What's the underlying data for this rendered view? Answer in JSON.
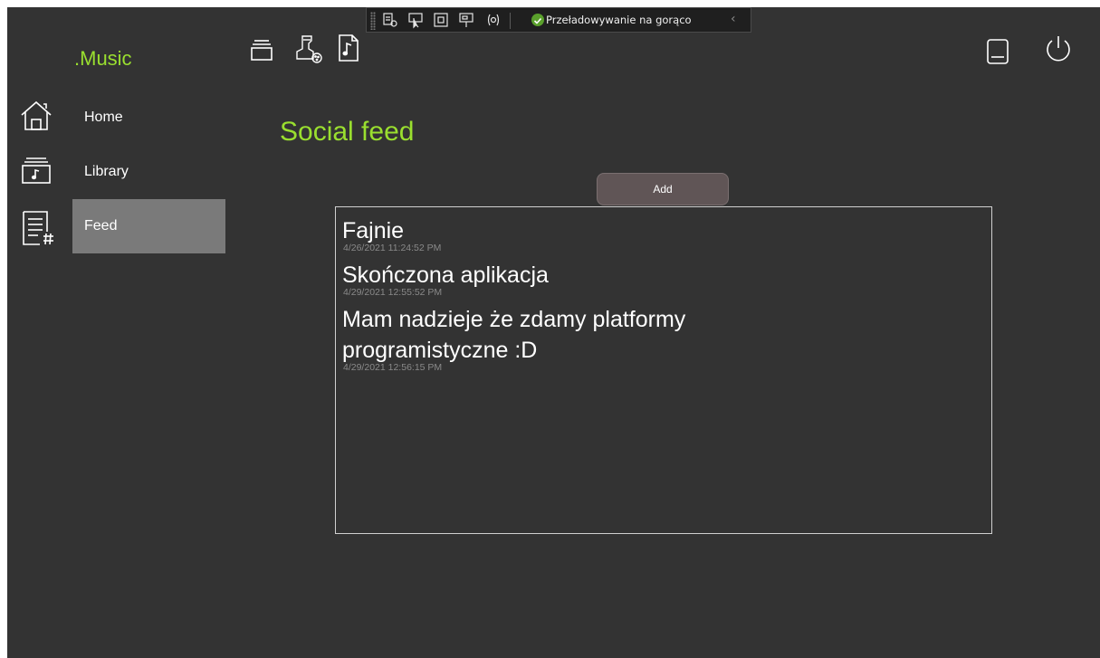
{
  "debug_toolbar": {
    "hot_reload_label": "Przeładowywanie na gorąco"
  },
  "app": {
    "brand": ".Music"
  },
  "sidebar": {
    "items": [
      {
        "label": "Home",
        "icon": "home-icon"
      },
      {
        "label": "Library",
        "icon": "library-icon"
      },
      {
        "label": "Feed",
        "icon": "feed-icon",
        "active": true
      }
    ]
  },
  "main": {
    "title": "Social feed",
    "add_label": "Add",
    "posts": [
      {
        "text": "Fajnie",
        "date": "4/26/2021 11:24:52 PM"
      },
      {
        "text": "Skończona aplikacja",
        "date": "4/29/2021 12:55:52 PM"
      },
      {
        "text": "Mam nadzieje że zdamy platformy programistyczne :D",
        "date": "4/29/2021 12:56:15 PM"
      }
    ]
  },
  "colors": {
    "background": "#333333",
    "accent": "#9adf2f",
    "active_nav": "#7a7a7a",
    "button": "#605556"
  }
}
